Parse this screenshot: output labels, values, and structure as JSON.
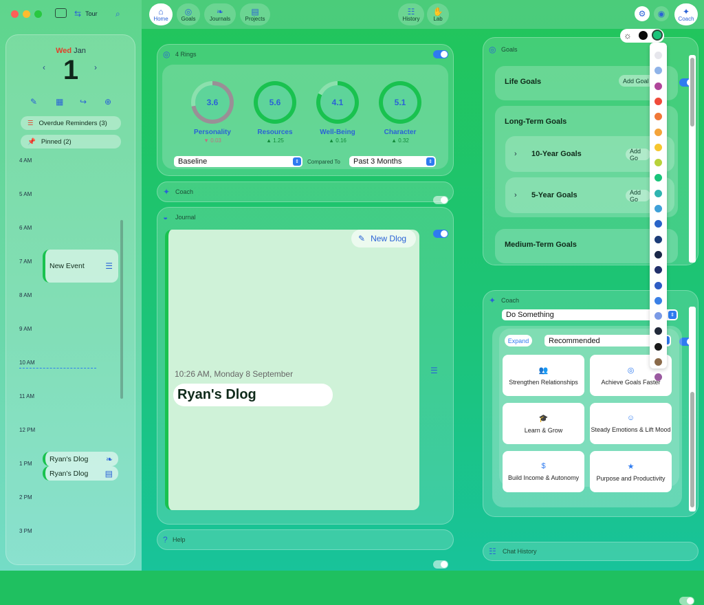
{
  "toolbar": {
    "tour": "Tour",
    "home": "Home",
    "goals": "Goals",
    "journals": "Journals",
    "projects": "Projects",
    "history": "History",
    "lab": "Lab",
    "coach": "Coach"
  },
  "calendar": {
    "weekday": "Wed",
    "month": "Jan",
    "day": "1",
    "overdue": "Overdue Reminders (3)",
    "pinned": "Pinned (2)",
    "hours": [
      "4 AM",
      "5 AM",
      "6 AM",
      "7 AM",
      "8 AM",
      "9 AM",
      "10 AM",
      "11 AM",
      "12 PM",
      "1 PM",
      "2 PM",
      "3 PM"
    ],
    "events": [
      "New Event",
      "Ryan's Dlog",
      "Ryan's Dlog"
    ]
  },
  "rings": {
    "title": "4 Rings",
    "items": [
      {
        "value": "3.6",
        "label": "Personality",
        "delta": "▼ 0.03",
        "color": "#9a8f96",
        "progress": 0.72
      },
      {
        "value": "5.6",
        "label": "Resources",
        "delta": "▲ 1.25",
        "color": "#19c24f",
        "progress": 1
      },
      {
        "value": "4.1",
        "label": "Well-Being",
        "delta": "▲ 0.16",
        "color": "#19c24f",
        "progress": 0.82
      },
      {
        "value": "5.1",
        "label": "Character",
        "delta": "▲ 0.32",
        "color": "#19c24f",
        "progress": 1
      }
    ],
    "baseline": "Baseline",
    "compared_to": "Compared To",
    "period": "Past 3 Months"
  },
  "coach_panel": {
    "title": "Coach"
  },
  "journal": {
    "title": "Journal",
    "new_dlog": "New Dlog",
    "timestamp": "10:26 AM, Monday 8 September",
    "entry_title": "Ryan's Dlog"
  },
  "help": {
    "title": "Help"
  },
  "goals": {
    "title": "Goals",
    "life": "Life Goals",
    "add_goal": "Add Goal",
    "long_term": "Long-Term Goals",
    "ten_year": "10-Year Goals",
    "five_year": "5-Year Goals",
    "add_go": "Add Go",
    "medium_term": "Medium-Term Goals"
  },
  "coach": {
    "title": "Coach",
    "select": "Do Something",
    "expand": "Expand",
    "recommended": "Recommended",
    "cards": [
      {
        "icon": "people-icon",
        "glyph": "👥",
        "label": "Strengthen Relationships"
      },
      {
        "icon": "target-icon",
        "glyph": "◎",
        "label": "Achieve Goals Faster"
      },
      {
        "icon": "graduation-cap-icon",
        "glyph": "🎓",
        "label": "Learn & Grow"
      },
      {
        "icon": "smile-icon",
        "glyph": "☺",
        "label": "Steady Emotions & Lift Mood"
      },
      {
        "icon": "dollar-icon",
        "glyph": "$",
        "label": "Build Income & Autonomy"
      },
      {
        "icon": "star-icon",
        "glyph": "★",
        "label": "Purpose and Productivity"
      }
    ]
  },
  "chat_history": {
    "title": "Chat History"
  },
  "swatches": [
    "#e6e6ec",
    "#8fb3e8",
    "#b0469a",
    "#f04a3a",
    "#f07838",
    "#f4a43a",
    "#f6c62e",
    "#b8d23a",
    "#19c47a",
    "#2fb4b0",
    "#3fa0d8",
    "#2a64c8",
    "#1c3c78",
    "#1a2848",
    "#22306a",
    "#2e5cc4",
    "#3a80e6",
    "#7a9ae6",
    "#222a3a",
    "#1a1a1a",
    "#8a6a4a",
    "#9a5aa0"
  ]
}
